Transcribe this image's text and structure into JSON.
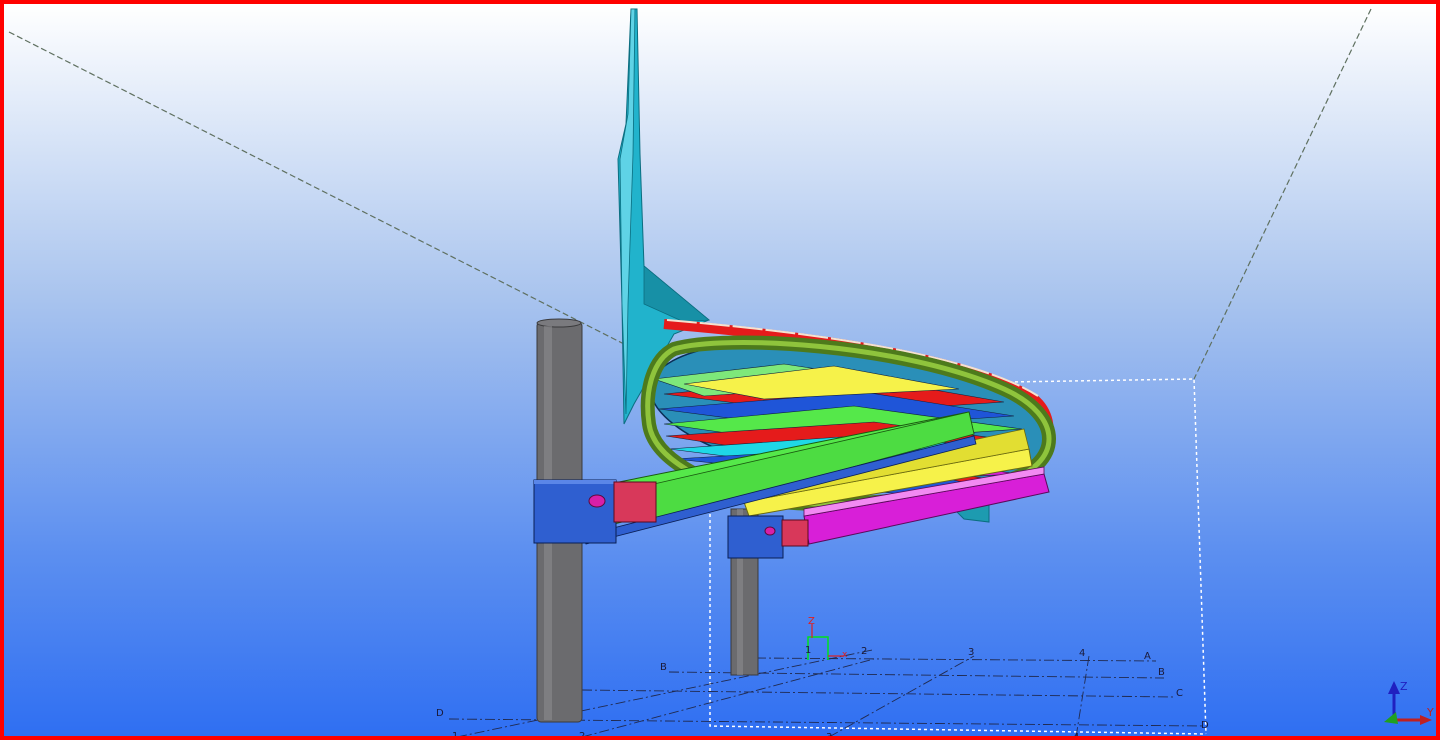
{
  "viewport": {
    "border_color": "#ff0000",
    "background_top": "#ffffff",
    "background_bottom": "#2f6ff2"
  },
  "grid": {
    "row_labels": [
      "A",
      "B",
      "C",
      "D"
    ],
    "column_labels": [
      "1",
      "2",
      "3",
      "4"
    ]
  },
  "work_plane_origin": {
    "label": "1",
    "axis_z": "Z",
    "axis_x": "x"
  },
  "view_axes": {
    "z_label": "Z",
    "y_label": "Y"
  },
  "colors": {
    "column": "#6b6b6e",
    "cap_plate": "#2f5fd0",
    "end_plate": "#d8385a",
    "beam_green": "#55e84a",
    "beam_yellow": "#f6f24a",
    "beam_magenta": "#d81fd8",
    "tube_ring": "#6f9e2a",
    "backrest": "#21b3cc",
    "slat_red": "#e51b1b",
    "slat_blue": "#1f55d8"
  }
}
